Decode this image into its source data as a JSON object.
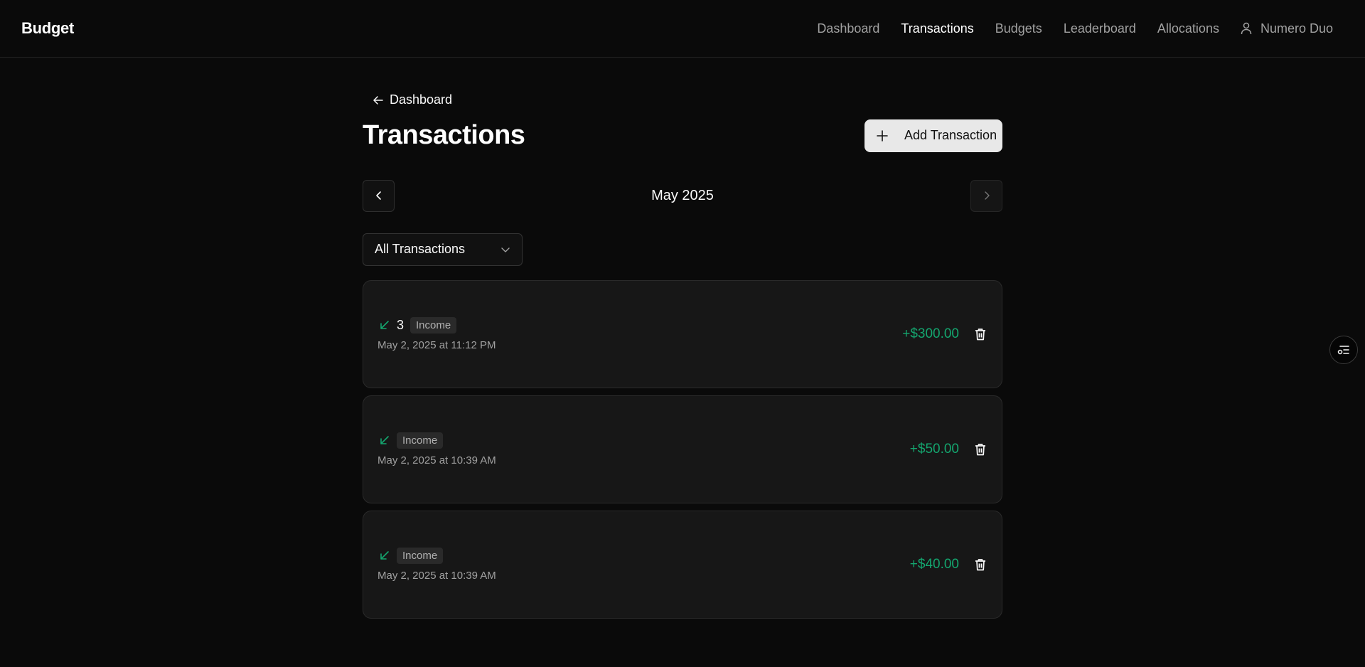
{
  "app": {
    "brand": "Budget"
  },
  "nav": {
    "items": [
      {
        "label": "Dashboard",
        "active": false
      },
      {
        "label": "Transactions",
        "active": true
      },
      {
        "label": "Budgets",
        "active": false
      },
      {
        "label": "Leaderboard",
        "active": false
      },
      {
        "label": "Allocations",
        "active": false
      }
    ],
    "user": {
      "label": "Numero Duo",
      "icon": "user-icon"
    }
  },
  "page": {
    "back_label": "Dashboard",
    "title": "Transactions",
    "add_button_label": "Add Transaction",
    "month_label": "May 2025",
    "filter_value": "All Transactions"
  },
  "transactions": [
    {
      "name": "3",
      "type": "Income",
      "date": "May 2, 2025 at 11:12 PM",
      "amount": "+$300.00"
    },
    {
      "name": "",
      "type": "Income",
      "date": "May 2, 2025 at 10:39 AM",
      "amount": "+$50.00"
    },
    {
      "name": "",
      "type": "Income",
      "date": "May 2, 2025 at 10:39 AM",
      "amount": "+$40.00"
    }
  ],
  "colors": {
    "income": "#14a66f",
    "background": "#0a0a0a",
    "card": "#171717"
  }
}
